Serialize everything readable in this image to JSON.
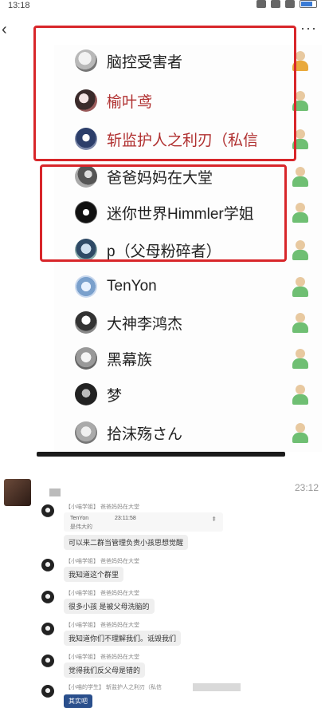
{
  "status_bar": {
    "time": "13:18"
  },
  "nav": {
    "back_icon": "‹",
    "more_icon": "···"
  },
  "members": [
    {
      "name": "脑控受害者",
      "name_color": "#222222",
      "role": "owner"
    },
    {
      "name": "榆叶鸢",
      "name_color": "#b03030",
      "role": "member"
    },
    {
      "name": "斩监护人之利刃（私信",
      "name_color": "#b03030",
      "role": "member"
    },
    {
      "name": "爸爸妈妈在大堂",
      "name_color": "#222222",
      "role": "member"
    },
    {
      "name": "迷你世界Himmler学姐",
      "name_color": "#222222",
      "role": "member"
    },
    {
      "name": "p（父母粉碎者）",
      "name_color": "#222222",
      "role": "member"
    },
    {
      "name": "TenYon",
      "name_color": "#222222",
      "role": "member"
    },
    {
      "name": "大神李鸿杰",
      "name_color": "#222222",
      "role": "member"
    },
    {
      "name": "黑幕族",
      "name_color": "#222222",
      "role": "member"
    },
    {
      "name": "梦",
      "name_color": "#222222",
      "role": "member"
    },
    {
      "name": "拾沫殇さん",
      "name_color": "#222222",
      "role": "member"
    }
  ],
  "chat": {
    "time": "23:12",
    "messages": [
      {
        "meta": "【小喵学姐】 爸爸妈妈在大堂",
        "quote": {
          "user": "TenYon",
          "time": "23:11:58",
          "text": "是伟大的"
        },
        "text": "可以来二群当管理负责小孩思想觉醒"
      },
      {
        "meta": "【小喵学姐】 爸爸妈妈在大堂",
        "text": "我知道这个群里"
      },
      {
        "meta": "【小喵学姐】 爸爸妈妈在大堂",
        "text": "很多小孩 是被父母洗脑的"
      },
      {
        "meta": "【小喵学姐】 爸爸妈妈在大堂",
        "text": "我知道你们不理解我们。诋毁我们"
      },
      {
        "meta": "【小喵学姐】 爸爸妈妈在大堂",
        "text": "觉得我们反父母是错的"
      },
      {
        "meta": "【小喵的学生】 斩监护人之利刃（私信",
        "text": "其实吧"
      }
    ]
  }
}
